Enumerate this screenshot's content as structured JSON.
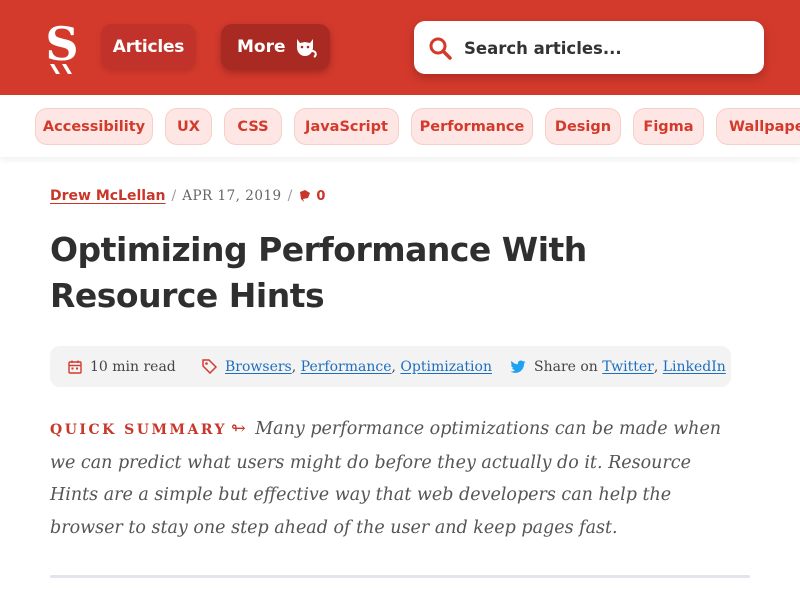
{
  "header": {
    "logo_letter": "S",
    "nav": {
      "articles_label": "Articles",
      "more_label": "More"
    },
    "search": {
      "placeholder": "Search articles..."
    },
    "colors": {
      "brand": "#d33a2c",
      "tag_bg": "#fde6e3",
      "link": "#1e6ec0"
    }
  },
  "tags": [
    "Accessibility",
    "UX",
    "CSS",
    "JavaScript",
    "Performance",
    "Design",
    "Figma",
    "Wallpapers"
  ],
  "article": {
    "author": "Drew McLellan",
    "separator": "/",
    "date": "APR 17, 2019",
    "comment_count": "0",
    "title": "Optimizing Performance With Resource Hints",
    "read_time": "10 min read",
    "categories": [
      "Browsers",
      "Performance",
      "Optimization"
    ],
    "share_label": "Share on",
    "share_links": [
      "Twitter",
      "LinkedIn"
    ],
    "summary_label": "Quick Summary",
    "summary_arrow": "↬",
    "summary_text": "Many performance optimizations can be made when we can predict what users might do before they actually do it. Resource Hints are a simple but effective way that web developers can help the browser to stay one step ahead of the user and keep pages fast."
  },
  "icons": {
    "logo": "smashing-logo",
    "more": "cat-icon",
    "search": "search-icon",
    "comments": "comment-icon",
    "calendar": "calendar-icon",
    "tag": "tag-icon",
    "twitter": "twitter-icon"
  }
}
